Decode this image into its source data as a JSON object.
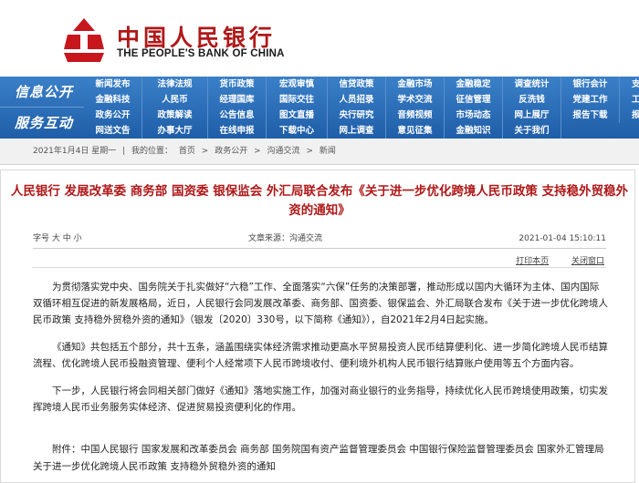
{
  "header": {
    "bank_name_cn": "中国人民银行",
    "bank_name_en": "THE PEOPLE'S BANK OF CHINA",
    "brand_color": "#b01818",
    "nav_color": "#2a6ab4"
  },
  "nav": {
    "section1_label": "信息公开",
    "section2_label": "服务互动",
    "rows": [
      [
        "新闻发布",
        "法律法规",
        "货币政策",
        "宏观审慎",
        "信贷政策",
        "金融市场",
        "金融稳定",
        "调查统计",
        "银行会计",
        "支付体系"
      ],
      [
        "金融科技",
        "人民币",
        "经理国库",
        "国际交往",
        "人员招录",
        "学术交流",
        "征信管理",
        "反洗钱",
        "党建工作",
        "工会工作"
      ],
      [
        "政务公开",
        "政策解读",
        "公告信息",
        "图文直播",
        "央行研究",
        "音频视频",
        "市场动态",
        "网上展厅",
        "报告下载",
        "报刊年鉴"
      ],
      [
        "网送文告",
        "办事大厅",
        "在线申报",
        "下载中心",
        "网上调查",
        "意见征集",
        "金融知识",
        "关于我们",
        "",
        ""
      ]
    ]
  },
  "breadcrumb": {
    "date": "2021年1月4日 星期一",
    "you_are_here": "我的位置：",
    "items": [
      "首页",
      "政务公开",
      "沟通交流",
      "新闻"
    ],
    "separator": "|"
  },
  "article": {
    "title": "人民银行 发展改革委 商务部 国资委 银保监会 外汇局联合发布《关于进一步优化跨境人民币政策 支持稳外贸稳外资的通知》",
    "font_size_label": "字号 大 中 小",
    "source": "文章来源：沟通交流",
    "date": "2021-01-04 15:10:11",
    "print_label": "打印本页",
    "close_label": "关闭窗口",
    "paragraphs": [
      "为贯彻落实党中央、国务院关于扎实做好“六稳”工作、全面落实“六保”任务的决策部署，推动形成以国内大循环为主体、国内国际双循环相互促进的新发展格局，近日，人民银行会同发展改革委、商务部、国资委、银保监会、外汇局联合发布《关于进一步优化跨境人民币政策 支持稳外贸稳外资的通知》（银发〔2020〕330号，以下简称《通知》），自2021年2月4日起实施。",
      "《通知》共包括五个部分，共十五条，涵盖围绕实体经济需求推动更高水平贸易投资人民币结算便利化、进一步简化跨境人民币结算流程、优化跨境人民币投融资管理、便利个人经常项下人民币跨境收付、便利境外机构人民币银行结算账户使用等五个方面内容。",
      "下一步，人民银行将会同相关部门做好《通知》落地实施工作，加强对商业银行的业务指导，持续优化人民币跨境使用政策，切实发挥跨境人民币业务服务实体经济、促进贸易投资便利化的作用。"
    ],
    "attachment": "附件：中国人民银行 国家发展和改革委员会 商务部 国务院国有资产监督管理委员会 中国银行保险监督管理委员会 国家外汇管理局关于进一步优化跨境人民币政策 支持稳外贸稳外资的通知"
  }
}
